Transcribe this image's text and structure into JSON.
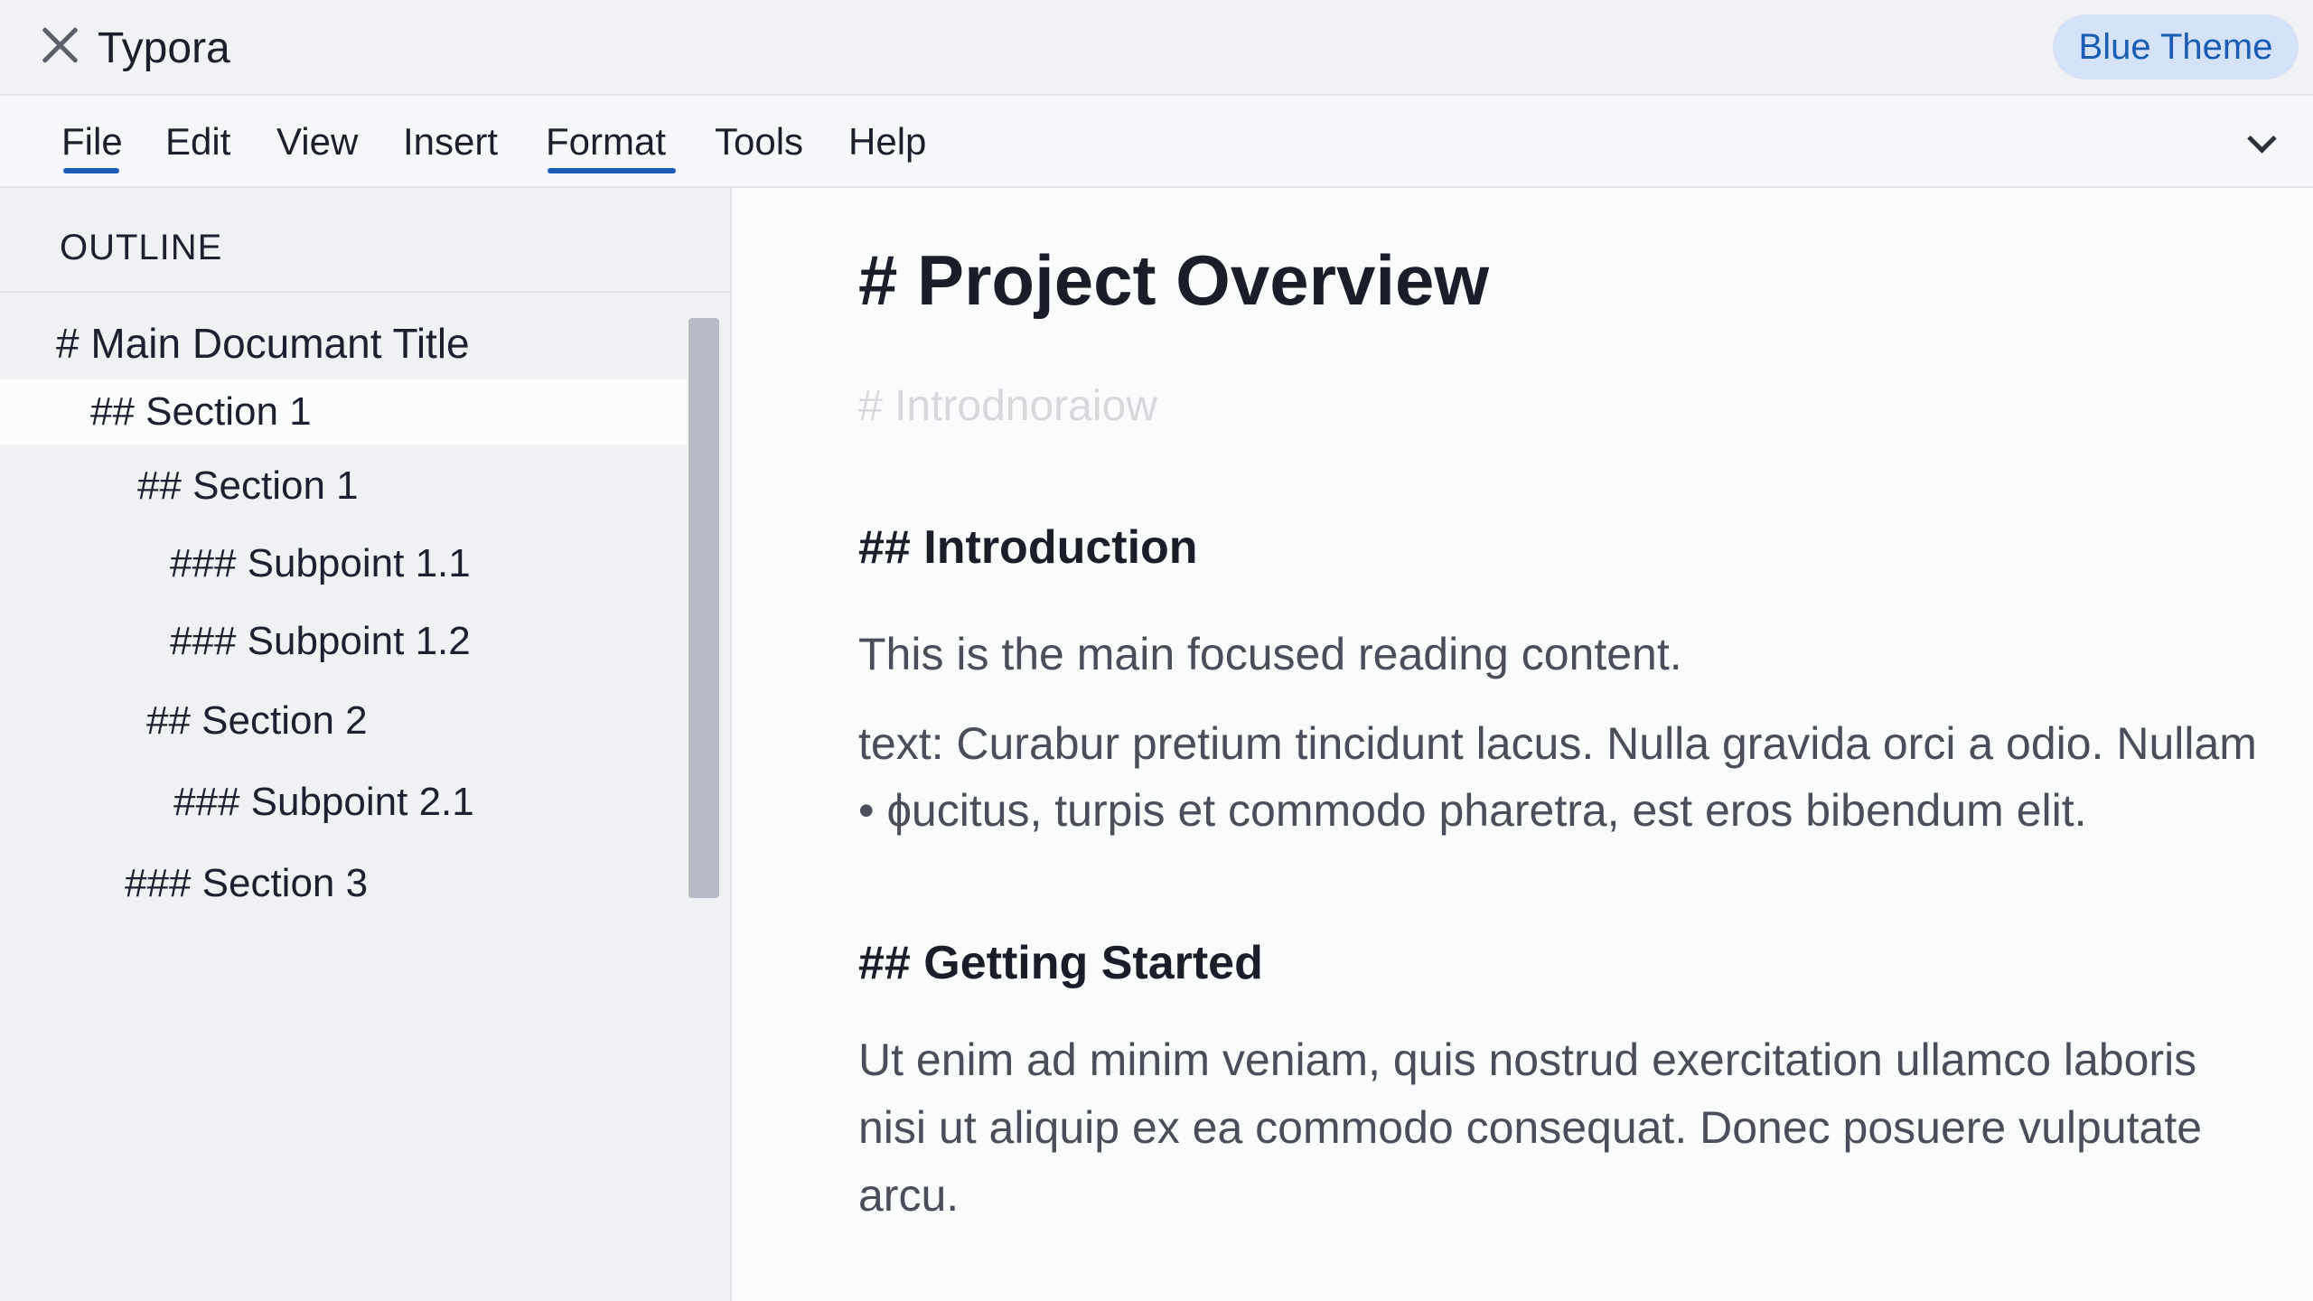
{
  "window": {
    "app_title": "Typora",
    "close_icon": "close-icon",
    "theme_badge": "Blue Theme"
  },
  "menu": {
    "items": [
      "File",
      "Edit",
      "View",
      "Insert",
      "Format",
      "Tools",
      "Help"
    ],
    "active": [
      "File",
      "Format"
    ],
    "overflow_icon": "chevron-down-icon"
  },
  "sidebar": {
    "header": "OUTLINE",
    "items": [
      {
        "label": "# Main Documant Title"
      },
      {
        "label": "## Section 1",
        "selected": true
      },
      {
        "label": "## Section 1"
      },
      {
        "label": "### Subpoint 1.1"
      },
      {
        "label": "### Subpoint 1.2"
      },
      {
        "label": "## Section 2"
      },
      {
        "label": "### Subpoint 2.1"
      },
      {
        "label": "### Section 3"
      }
    ]
  },
  "editor": {
    "title": "# Project Overview",
    "ghost_line": "#  Introdnoraiow",
    "sections": [
      {
        "heading": "## Introduction",
        "paragraphs": [
          "This is the main focused reading content.",
          "text: Curabur pretium tincidunt lacus. Nulla gravida orci a odio. Nullam • ɸucitus, turpis et commodo pharetra, est eros bibendum elit."
        ]
      },
      {
        "heading": "## Getting Started",
        "paragraphs": [
          "Ut enim ad minim veniam, quis nostrud exercitation ullamco laboris nisi ut aliquip ex ea commodo consequat. Donec posuere vulputate arcu."
        ]
      }
    ]
  },
  "colors": {
    "accent": "#1a5bb3",
    "badge_bg": "#d3e2f7",
    "text": "#1d2130",
    "body_text": "#4a4e5a",
    "scrollbar": "#b7bbc6"
  }
}
